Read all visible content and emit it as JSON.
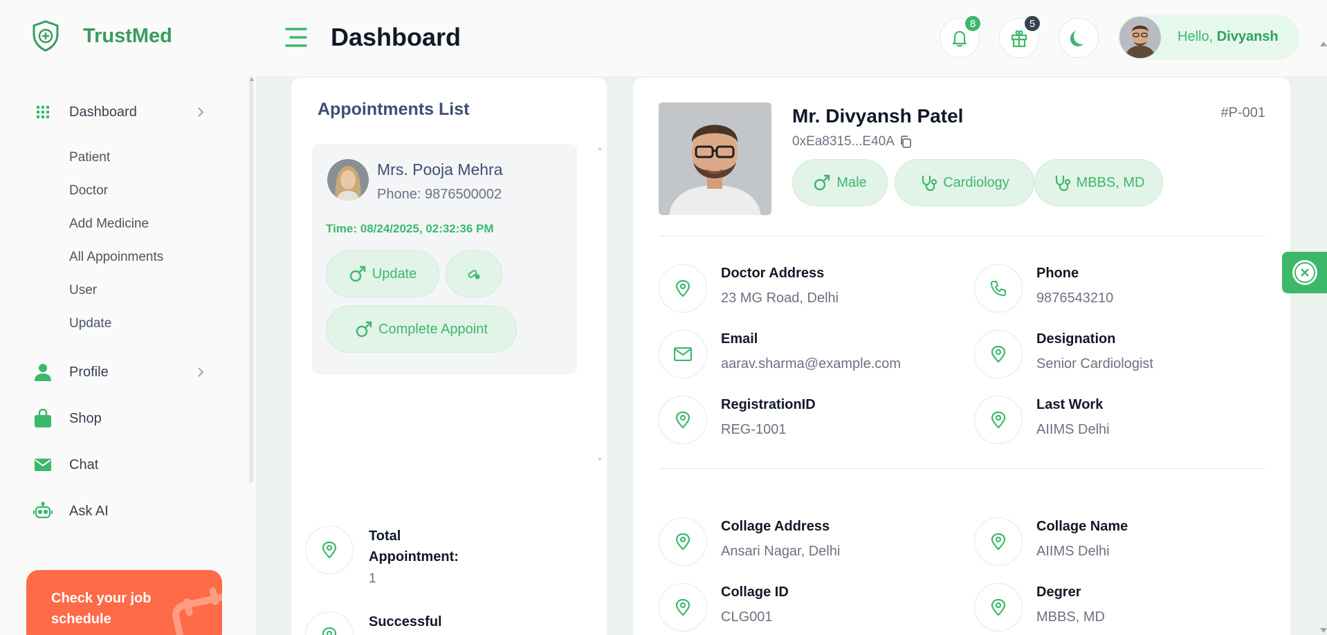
{
  "app": {
    "name": "TrustMed"
  },
  "header": {
    "title": "Dashboard",
    "notifications_count": "8",
    "gifts_count": "5",
    "greeting": "Hello,",
    "user_name": "Divyansh"
  },
  "sidebar": {
    "dashboard": "Dashboard",
    "sub_items": [
      "Patient",
      "Doctor",
      "Add Medicine",
      "All Appoinments",
      "User",
      "Update"
    ],
    "profile": "Profile",
    "shop": "Shop",
    "chat": "Chat",
    "ask_ai": "Ask AI",
    "promo": "Check your job schedule"
  },
  "appointments": {
    "title": "Appointments List",
    "items": [
      {
        "name": "Mrs. Pooja Mehra",
        "phone": "Phone: 9876500002",
        "time": "Time: 08/24/2025, 02:32:36 PM",
        "update_label": "Update",
        "complete_label": "Complete Appoint"
      }
    ],
    "stats": [
      {
        "label": "Total Appointment:",
        "value": "1"
      },
      {
        "label": "Successful",
        "value": ""
      }
    ]
  },
  "profile": {
    "name": "Mr. Divyansh Patel",
    "wallet": "0xEa8315...E40A",
    "id": "#P-001",
    "tags": [
      "Male",
      "Cardiology",
      "MBBS, MD"
    ],
    "details": [
      {
        "label": "Doctor Address",
        "value": "23 MG Road, Delhi",
        "icon": "location-pin-icon"
      },
      {
        "label": "Phone",
        "value": "9876543210",
        "icon": "phone-icon"
      },
      {
        "label": "Email",
        "value": "aarav.sharma@example.com",
        "icon": "mail-icon"
      },
      {
        "label": "Designation",
        "value": "Senior Cardiologist",
        "icon": "location-pin-icon"
      },
      {
        "label": "RegistrationID",
        "value": "REG-1001",
        "icon": "location-pin-icon"
      },
      {
        "label": "Last Work",
        "value": "AIIMS Delhi",
        "icon": "location-pin-icon"
      }
    ],
    "college": [
      {
        "label": "Collage Address",
        "value": "Ansari Nagar, Delhi",
        "icon": "location-pin-icon"
      },
      {
        "label": "Collage Name",
        "value": "AIIMS Delhi",
        "icon": "location-pin-icon"
      },
      {
        "label": "Collage ID",
        "value": "CLG001",
        "icon": "location-pin-icon"
      },
      {
        "label": "Degrer",
        "value": "MBBS, MD",
        "icon": "location-pin-icon"
      }
    ]
  },
  "colors": {
    "brand_green": "#3cb86a",
    "promo_orange": "#ff6b47",
    "title_navy": "#3d4f73"
  }
}
